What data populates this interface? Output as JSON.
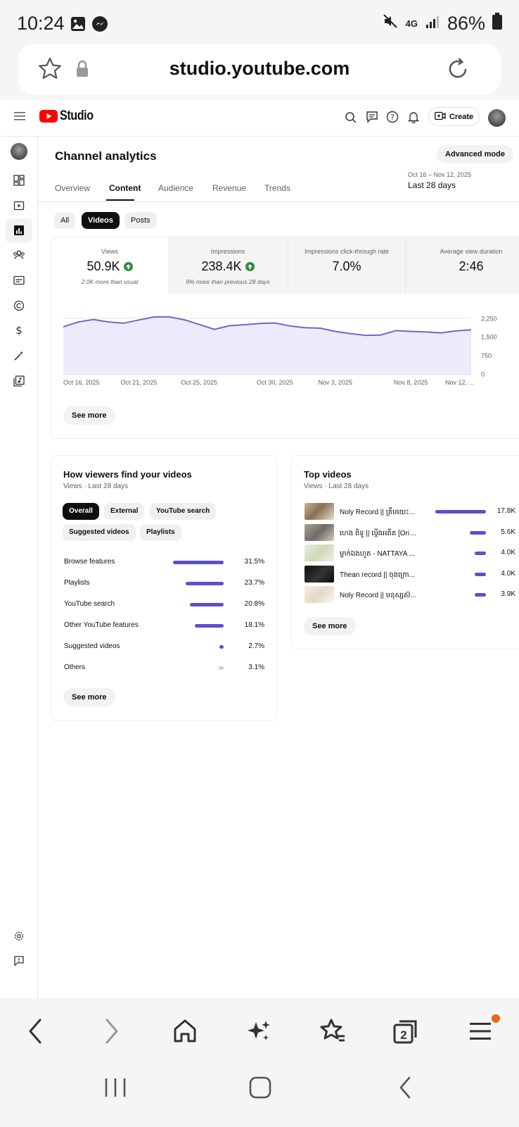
{
  "status": {
    "time": "10:24",
    "network": "4G",
    "battery": "86%"
  },
  "browser": {
    "url": "studio.youtube.com",
    "tab_count": "2"
  },
  "topbar": {
    "logo_text": "Studio",
    "create_label": "Create"
  },
  "page": {
    "title": "Channel analytics",
    "advanced_mode_label": "Advanced mode",
    "tabs": [
      {
        "label": "Overview"
      },
      {
        "label": "Content"
      },
      {
        "label": "Audience"
      },
      {
        "label": "Revenue"
      },
      {
        "label": "Trends"
      }
    ],
    "date_range": {
      "dates": "Oct 16 – Nov 12, 2025",
      "period": "Last 28 days"
    },
    "filters": [
      {
        "label": "All"
      },
      {
        "label": "Videos"
      },
      {
        "label": "Posts"
      }
    ]
  },
  "metrics": [
    {
      "label": "Views",
      "value": "50.9K",
      "subtext": "2.0K more than usual"
    },
    {
      "label": "Impressions",
      "value": "238.4K",
      "subtext": "9% more than previous 28 days"
    },
    {
      "label": "Impressions click-through rate",
      "value": "7.0%",
      "subtext": ""
    },
    {
      "label": "Average view duration",
      "value": "2:46",
      "subtext": ""
    }
  ],
  "chart_data": {
    "type": "area",
    "x": [
      "Oct 16",
      "Oct 17",
      "Oct 18",
      "Oct 19",
      "Oct 20",
      "Oct 21",
      "Oct 22",
      "Oct 23",
      "Oct 24",
      "Oct 25",
      "Oct 26",
      "Oct 27",
      "Oct 28",
      "Oct 29",
      "Oct 30",
      "Oct 31",
      "Nov 1",
      "Nov 2",
      "Nov 3",
      "Nov 4",
      "Nov 5",
      "Nov 6",
      "Nov 7",
      "Nov 8",
      "Nov 9",
      "Nov 10",
      "Nov 11",
      "Nov 12"
    ],
    "values": [
      1900,
      2100,
      2200,
      2100,
      2050,
      2180,
      2300,
      2300,
      2190,
      2000,
      1800,
      1950,
      1990,
      2040,
      2060,
      1940,
      1870,
      1850,
      1720,
      1630,
      1560,
      1570,
      1750,
      1720,
      1700,
      1660,
      1740,
      1780
    ],
    "xtick_labels": [
      "Oct 16, 2025",
      "Oct 21, 2025",
      "Oct 25, 2025",
      "Oct 30, 2025",
      "Nov 3, 2025",
      "Nov 8, 2025",
      "Nov 12, ..."
    ],
    "xtick_index": [
      0,
      5,
      9,
      14,
      18,
      23,
      27
    ],
    "yticks": [
      0,
      750,
      1500,
      2250
    ],
    "ytick_labels": [
      "0",
      "750",
      "1,500",
      "2,250"
    ],
    "ylim": [
      0,
      2500
    ],
    "grid": true,
    "colors": {
      "line": "#7067c9",
      "fill": "#ecebfb"
    }
  },
  "see_more_label": "See more",
  "traffic": {
    "title": "How viewers find your videos",
    "subtitle": "Views · Last 28 days",
    "chips": [
      "Overall",
      "External",
      "YouTube search",
      "Suggested videos",
      "Playlists"
    ],
    "rows": [
      {
        "label": "Browse features",
        "percent": 31.5,
        "value": "31.5%"
      },
      {
        "label": "Playlists",
        "percent": 23.7,
        "value": "23.7%"
      },
      {
        "label": "YouTube search",
        "percent": 20.8,
        "value": "20.8%"
      },
      {
        "label": "Other YouTube features",
        "percent": 18.1,
        "value": "18.1%"
      },
      {
        "label": "Suggested videos",
        "percent": 2.7,
        "value": "2.7%"
      },
      {
        "label": "Others",
        "percent": 3.1,
        "value": "3.1%"
      }
    ]
  },
  "top_videos": {
    "title": "Top videos",
    "subtitle": "Views · Last 28 days",
    "items": [
      {
        "title": "Noly Record || ត្រឹមយេះ...",
        "views": 17800,
        "value": "17.8K"
      },
      {
        "title": "ហេង ពិទូ || ម្ចើងអតីត [Orig...",
        "views": 5600,
        "value": "5.6K"
      },
      {
        "title": "ម្ចាក់ឯងហួត - NATTAYA ...",
        "views": 4000,
        "value": "4.0K"
      },
      {
        "title": "Thean record || ចុងក្រោ...",
        "views": 4000,
        "value": "4.0K"
      },
      {
        "title": "Noly Record || មនុស្សស៊...",
        "views": 3900,
        "value": "3.9K"
      }
    ]
  },
  "colors": {
    "accent": "#5a4fcf",
    "youtube_red": "#ff0000",
    "up_green": "#2e8b3a",
    "notif_dot": "#e8651c"
  }
}
